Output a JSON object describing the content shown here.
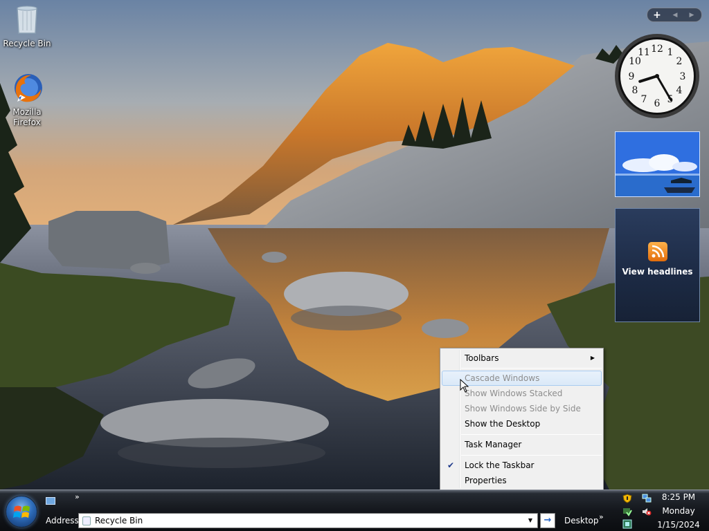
{
  "desktop": {
    "icons": [
      {
        "label": "Recycle Bin",
        "icon": "recycle-bin-icon"
      },
      {
        "label": "Mozilla Firefox",
        "icon": "firefox-icon"
      }
    ]
  },
  "gadgets": {
    "toolbar": {
      "add": "+",
      "prev": "◀",
      "next": "▶"
    },
    "clock": {
      "hour": 8,
      "minute": 25
    },
    "feed": {
      "label": "View headlines",
      "icon": "rss-icon"
    }
  },
  "context_menu": {
    "items": [
      {
        "label": "Toolbars",
        "enabled": true,
        "submenu": true
      },
      {
        "label": "Cascade Windows",
        "enabled": false,
        "hover": true
      },
      {
        "label": "Show Windows Stacked",
        "enabled": false
      },
      {
        "label": "Show Windows Side by Side",
        "enabled": false
      },
      {
        "label": "Show the Desktop",
        "enabled": true
      },
      {
        "label": "Task Manager",
        "enabled": true
      },
      {
        "label": "Lock the Taskbar",
        "enabled": true,
        "checked": true
      },
      {
        "label": "Properties",
        "enabled": true
      }
    ]
  },
  "taskbar": {
    "quick_launch_chevron": "»",
    "address_label": "Address",
    "address_value": "Recycle Bin",
    "go_label": "→",
    "desktop_toolbar_label": "Desktop",
    "desktop_chevron": "»",
    "clock": {
      "time": "8:25 PM",
      "day": "Monday",
      "date": "1/15/2024"
    }
  },
  "colors": {
    "menu_background": "#f0f0f0",
    "menu_highlight": "#dbe9f8",
    "menu_disabled_text": "#8d8d8d",
    "taskbar_dark": "#14171c"
  }
}
